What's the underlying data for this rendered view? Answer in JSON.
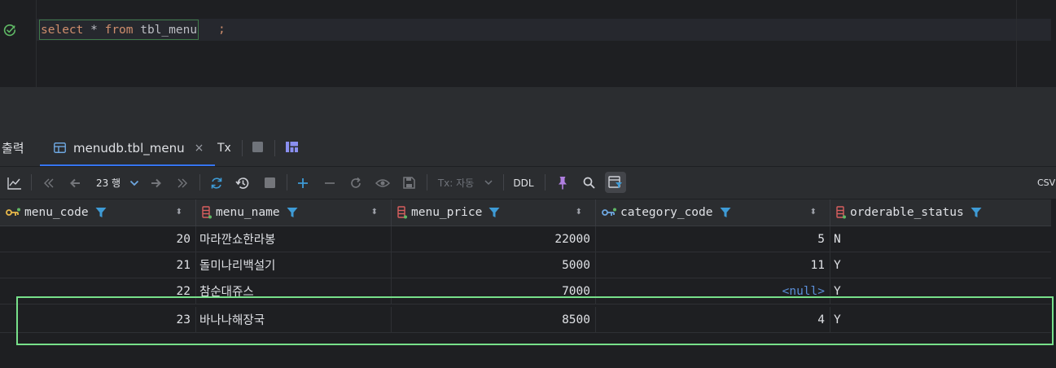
{
  "editor": {
    "sql": {
      "kw_select": "select",
      "star": " * ",
      "kw_from": "from",
      "table": " tbl_menu",
      "semicolon": ";"
    }
  },
  "tabs": {
    "output_label": "출력",
    "table_tab_label": "menudb.tbl_menu",
    "close_glyph": "×",
    "tx_label": "Tx"
  },
  "toolbar": {
    "rows_label": "23 행",
    "tx_mode": "Tx: 자동",
    "ddl_label": "DDL",
    "csv_label": "CSV"
  },
  "grid": {
    "columns": [
      {
        "name": "menu_code",
        "icon": "primary-key-icon"
      },
      {
        "name": "menu_name",
        "icon": "column-icon"
      },
      {
        "name": "menu_price",
        "icon": "column-icon"
      },
      {
        "name": "category_code",
        "icon": "foreign-key-icon"
      },
      {
        "name": "orderable_status",
        "icon": "column-icon"
      }
    ],
    "sort_glyph": "⬍",
    "rows": [
      {
        "menu_code": "20",
        "menu_name": "마라깐쇼한라봉",
        "menu_price": "22000",
        "category_code": "5",
        "orderable_status": "N"
      },
      {
        "menu_code": "21",
        "menu_name": "돌미나리백설기",
        "menu_price": "5000",
        "category_code": "11",
        "orderable_status": "Y"
      },
      {
        "menu_code": "22",
        "menu_name": "참순대쥬스",
        "menu_price": "7000",
        "category_code": "<null>",
        "orderable_status": "Y"
      },
      {
        "menu_code": "23",
        "menu_name": "바나나해장국",
        "menu_price": "8500",
        "category_code": "4",
        "orderable_status": "Y"
      }
    ]
  },
  "colors": {
    "background": "#1e1f22",
    "panel": "#2b2d30",
    "keyword": "#cf8e6d",
    "accent_blue": "#3574f0",
    "null_blue": "#5b8fd9",
    "selection_green": "#77e08a",
    "add_blue": "#3e9bd6",
    "pin_purple": "#b07fe0"
  }
}
